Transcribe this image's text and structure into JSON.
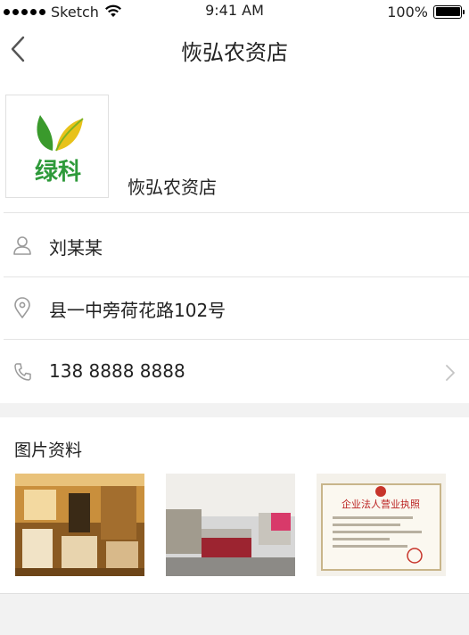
{
  "status_bar": {
    "carrier": "Sketch",
    "time": "9:41 AM",
    "battery": "100%",
    "battery_level": 1.0
  },
  "nav": {
    "title": "恢弘农资店",
    "back_icon": "chevron-left-icon"
  },
  "store": {
    "logo_text": "绿科",
    "name": "恢弘农资店",
    "contact_name": "刘某某",
    "address": "县一中旁荷花路102号",
    "phone": "138 8888 8888"
  },
  "photos": {
    "title": "图片资料",
    "license_title": "企业法人营业执照"
  },
  "colors": {
    "logo_green": "#2e9a3a",
    "logo_yellow": "#e8c21a",
    "divider": "#e4e4e4",
    "icon_gray": "#9a9a9a"
  }
}
